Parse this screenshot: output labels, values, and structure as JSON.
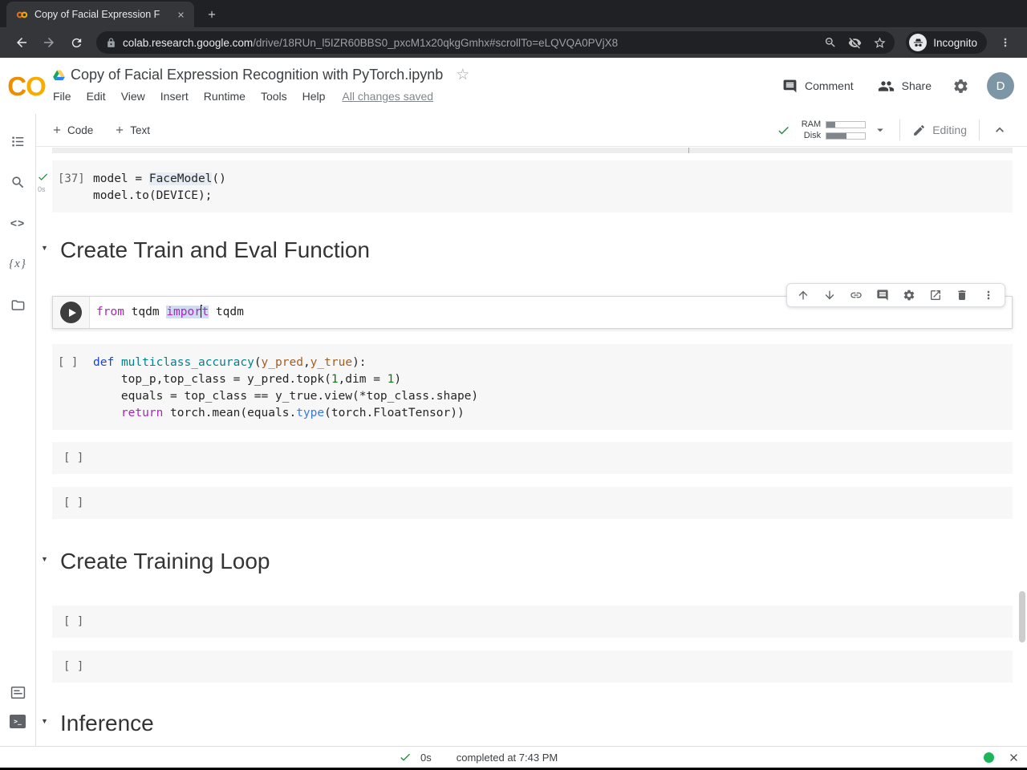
{
  "browser": {
    "tab_title": "Copy of Facial Expression F",
    "url_host": "colab.research.google.com",
    "url_path": "/drive/18RUn_l5IZR60BBS0_pxcM1x20qkgGmhx#scrollTo=eLQVQA0PVjX8",
    "incognito_label": "Incognito"
  },
  "header": {
    "logo_c": "C",
    "logo_o": "O",
    "title": "Copy of Facial Expression Recognition with PyTorch.ipynb",
    "menus": [
      "File",
      "Edit",
      "View",
      "Insert",
      "Runtime",
      "Tools",
      "Help"
    ],
    "save_status": "All changes saved",
    "comment_label": "Comment",
    "share_label": "Share",
    "avatar_letter": "D"
  },
  "toolbar": {
    "code_label": "Code",
    "text_label": "Text",
    "ram_label": "RAM",
    "disk_label": "Disk",
    "ram_pct": 22,
    "disk_pct": 52,
    "editing_label": "Editing"
  },
  "sidebar": {
    "icons": [
      "table-of-contents",
      "search",
      "code-snippets",
      "variables",
      "files"
    ],
    "code_glyph": "<>",
    "vars_glyph": "{x}",
    "bottom_icons": [
      "command-palette",
      "terminal"
    ],
    "terminal_glyph": ">_"
  },
  "cell_toolbar_icons": [
    "move-cell-up",
    "move-cell-down",
    "copy-link",
    "add-comment",
    "cell-settings",
    "open-in-tab",
    "delete-cell",
    "more-actions"
  ],
  "notebook": {
    "cells": [
      {
        "type": "code",
        "prompt": "[37]",
        "status_check": true,
        "exec_time": "0s",
        "lines": [
          [
            {
              "t": "model = "
            },
            {
              "c": "match",
              "t": "FaceModel"
            },
            {
              "t": "()"
            }
          ],
          [
            {
              "t": "model.to(DEVICE);"
            }
          ]
        ]
      },
      {
        "type": "markdown",
        "text": "Create Train and Eval Function"
      },
      {
        "type": "focused",
        "lines": [
          [
            {
              "c": "kw",
              "t": "from"
            },
            {
              "t": " tqdm "
            },
            {
              "c": "kw sel",
              "t": "impor"
            },
            {
              "c": "caret"
            },
            {
              "c": "kw sel",
              "t": "t"
            },
            {
              "t": " tqdm"
            }
          ]
        ]
      },
      {
        "type": "code",
        "prompt": "[ ]",
        "lines": [
          [
            {
              "c": "kwd",
              "t": "def"
            },
            {
              "t": " "
            },
            {
              "c": "fn",
              "t": "multiclass_accuracy"
            },
            {
              "t": "("
            },
            {
              "c": "param",
              "t": "y_pred"
            },
            {
              "t": ","
            },
            {
              "c": "param",
              "t": "y_true"
            },
            {
              "t": "):"
            }
          ],
          [
            {
              "t": "    top_p,top_class = y_pred.topk("
            },
            {
              "c": "num",
              "t": "1"
            },
            {
              "t": ",dim = "
            },
            {
              "c": "num",
              "t": "1"
            },
            {
              "t": ")"
            }
          ],
          [
            {
              "t": "    equals = top_class == y_true.view(*top_class.shape)"
            }
          ],
          [
            {
              "t": "    "
            },
            {
              "c": "kw",
              "t": "return"
            },
            {
              "t": " torch.mean(equals."
            },
            {
              "c": "blt",
              "t": "type"
            },
            {
              "t": "(torch.FloatTensor))"
            }
          ]
        ]
      },
      {
        "type": "empty",
        "prompt": "[ ]"
      },
      {
        "type": "empty",
        "prompt": "[ ]"
      },
      {
        "type": "markdown",
        "text": "Create Training Loop"
      },
      {
        "type": "empty",
        "prompt": "[ ]"
      },
      {
        "type": "empty",
        "prompt": "[ ]"
      },
      {
        "type": "markdown",
        "text": "Inference"
      }
    ]
  },
  "statusbar": {
    "duration": "0s",
    "message": "completed at 7:43 PM"
  },
  "colors": {
    "green": "#1e8e3e",
    "logo-orange": "#F9AB00",
    "logo-orange-dark": "#ED8E00",
    "avatar-bg": "#7d96a5",
    "kw": "#a727b8",
    "kwd": "#1b44d0",
    "fn": "#00838f",
    "param": "#a55d20",
    "num": "#107a10",
    "blt": "#3b78e7",
    "selbg": "#cfdbf5",
    "matchbg": "#e6ecf4",
    "cellbg": "#f7f7f7",
    "statusdot": "#1db45a"
  }
}
